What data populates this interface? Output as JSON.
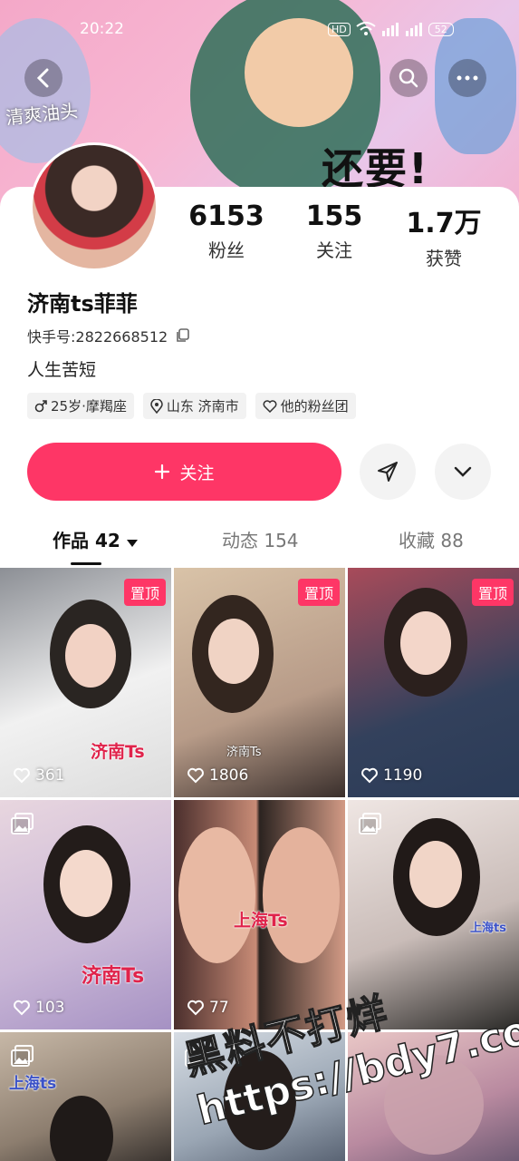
{
  "status_bar": {
    "time": "20:22",
    "network": "HD",
    "battery": "52"
  },
  "banner": {
    "text_left": "清爽油头",
    "text_right": "还要!"
  },
  "profile": {
    "name": "济南ts菲菲",
    "kuaishou_id_label": "快手号:",
    "kuaishou_id": "2822668512",
    "bio": "人生苦短",
    "stats": [
      {
        "value": "6153",
        "label": "粉丝"
      },
      {
        "value": "155",
        "label": "关注"
      },
      {
        "value": "1.7万",
        "label": "获赞"
      }
    ],
    "tags": [
      {
        "icon": "male-icon",
        "text": "25岁·摩羯座"
      },
      {
        "icon": "location-icon",
        "text": "山东 济南市"
      },
      {
        "icon": "heart-outline-icon",
        "text": "他的粉丝团"
      }
    ]
  },
  "actions": {
    "follow_label": "关注",
    "share_icon": "send-icon",
    "more_icon": "chevron-down-icon"
  },
  "tabs": [
    {
      "label": "作品 42",
      "active": true
    },
    {
      "label": "动态 154",
      "active": false
    },
    {
      "label": "收藏 88",
      "active": false
    }
  ],
  "grid": [
    {
      "pinned": true,
      "pin_label": "置顶",
      "likes": "361",
      "caption": "济南Ts",
      "type": "video"
    },
    {
      "pinned": true,
      "pin_label": "置顶",
      "likes": "1806",
      "caption": "济南Ts",
      "type": "video"
    },
    {
      "pinned": true,
      "pin_label": "置顶",
      "likes": "1190",
      "caption": "",
      "type": "video"
    },
    {
      "pinned": false,
      "likes": "103",
      "caption": "济南Ts",
      "type": "gallery"
    },
    {
      "pinned": false,
      "likes": "77",
      "caption": "上海Ts",
      "type": "video"
    },
    {
      "pinned": false,
      "likes": "",
      "caption": "上海ts",
      "type": "gallery"
    },
    {
      "pinned": false,
      "likes": "",
      "caption": "上海ts",
      "type": "gallery"
    },
    {
      "pinned": false,
      "likes": "",
      "caption": "",
      "type": "gallery"
    },
    {
      "pinned": false,
      "likes": "",
      "caption": "",
      "type": "video"
    }
  ],
  "watermark": {
    "line1": "黑料不打烊",
    "line2": "https://bdy7.co"
  },
  "colors": {
    "accent": "#fe3666",
    "banner": "#f4a8c8"
  }
}
